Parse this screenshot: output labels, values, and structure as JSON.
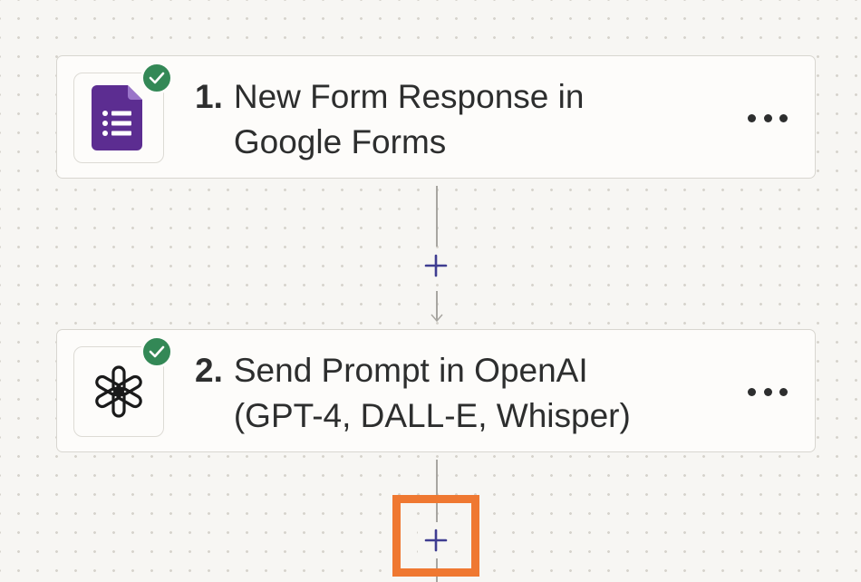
{
  "steps": [
    {
      "number": "1.",
      "title_line1": "New Form Response in",
      "title_line2": "Google Forms",
      "app_icon": "google-forms-icon",
      "status_icon": "check-circle-icon",
      "menu_icon": "more-horizontal-icon"
    },
    {
      "number": "2.",
      "title_line1": "Send Prompt in OpenAI",
      "title_line2": "(GPT-4, DALL-E, Whisper)",
      "app_icon": "openai-icon",
      "status_icon": "check-circle-icon",
      "menu_icon": "more-horizontal-icon"
    }
  ],
  "connectors": [
    {
      "add_icon": "plus-icon",
      "highlighted": false
    },
    {
      "add_icon": "plus-icon",
      "highlighted": true
    }
  ],
  "colors": {
    "canvas_bg": "#f7f6f3",
    "card_bg": "#fdfcfa",
    "check_green": "#338856",
    "plus_blue": "#3f3d91",
    "forms_purple": "#5c2d91",
    "highlight_orange": "#ef7831"
  }
}
